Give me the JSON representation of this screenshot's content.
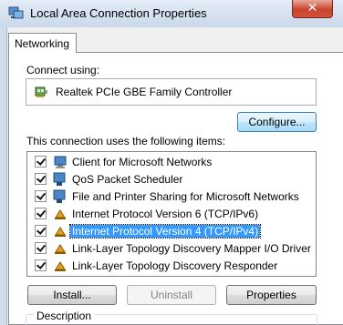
{
  "window": {
    "title": "Local Area Connection Properties",
    "close_glyph": "✕"
  },
  "tabs": [
    {
      "label": "Networking"
    }
  ],
  "connect_using": {
    "label": "Connect using:",
    "adapter": "Realtek PCIe GBE Family Controller",
    "configure_label": "Configure..."
  },
  "items_section": {
    "label": "This connection uses the following items:",
    "items": [
      {
        "label": "Client for Microsoft Networks",
        "checked": true,
        "icon": "client-icon"
      },
      {
        "label": "QoS Packet Scheduler",
        "checked": true,
        "icon": "service-icon"
      },
      {
        "label": "File and Printer Sharing for Microsoft Networks",
        "checked": true,
        "icon": "service-icon"
      },
      {
        "label": "Internet Protocol Version 6 (TCP/IPv6)",
        "checked": true,
        "icon": "protocol-icon"
      },
      {
        "label": "Internet Protocol Version 4 (TCP/IPv4)",
        "checked": true,
        "icon": "protocol-icon",
        "selected": true
      },
      {
        "label": "Link-Layer Topology Discovery Mapper I/O Driver",
        "checked": true,
        "icon": "protocol-icon"
      },
      {
        "label": "Link-Layer Topology Discovery Responder",
        "checked": true,
        "icon": "protocol-icon"
      }
    ]
  },
  "buttons": {
    "install": "Install...",
    "uninstall": "Uninstall",
    "properties": "Properties"
  },
  "description": {
    "label": "Description"
  },
  "colors": {
    "selection": "#3399ff",
    "close_button": "#c8452e"
  }
}
